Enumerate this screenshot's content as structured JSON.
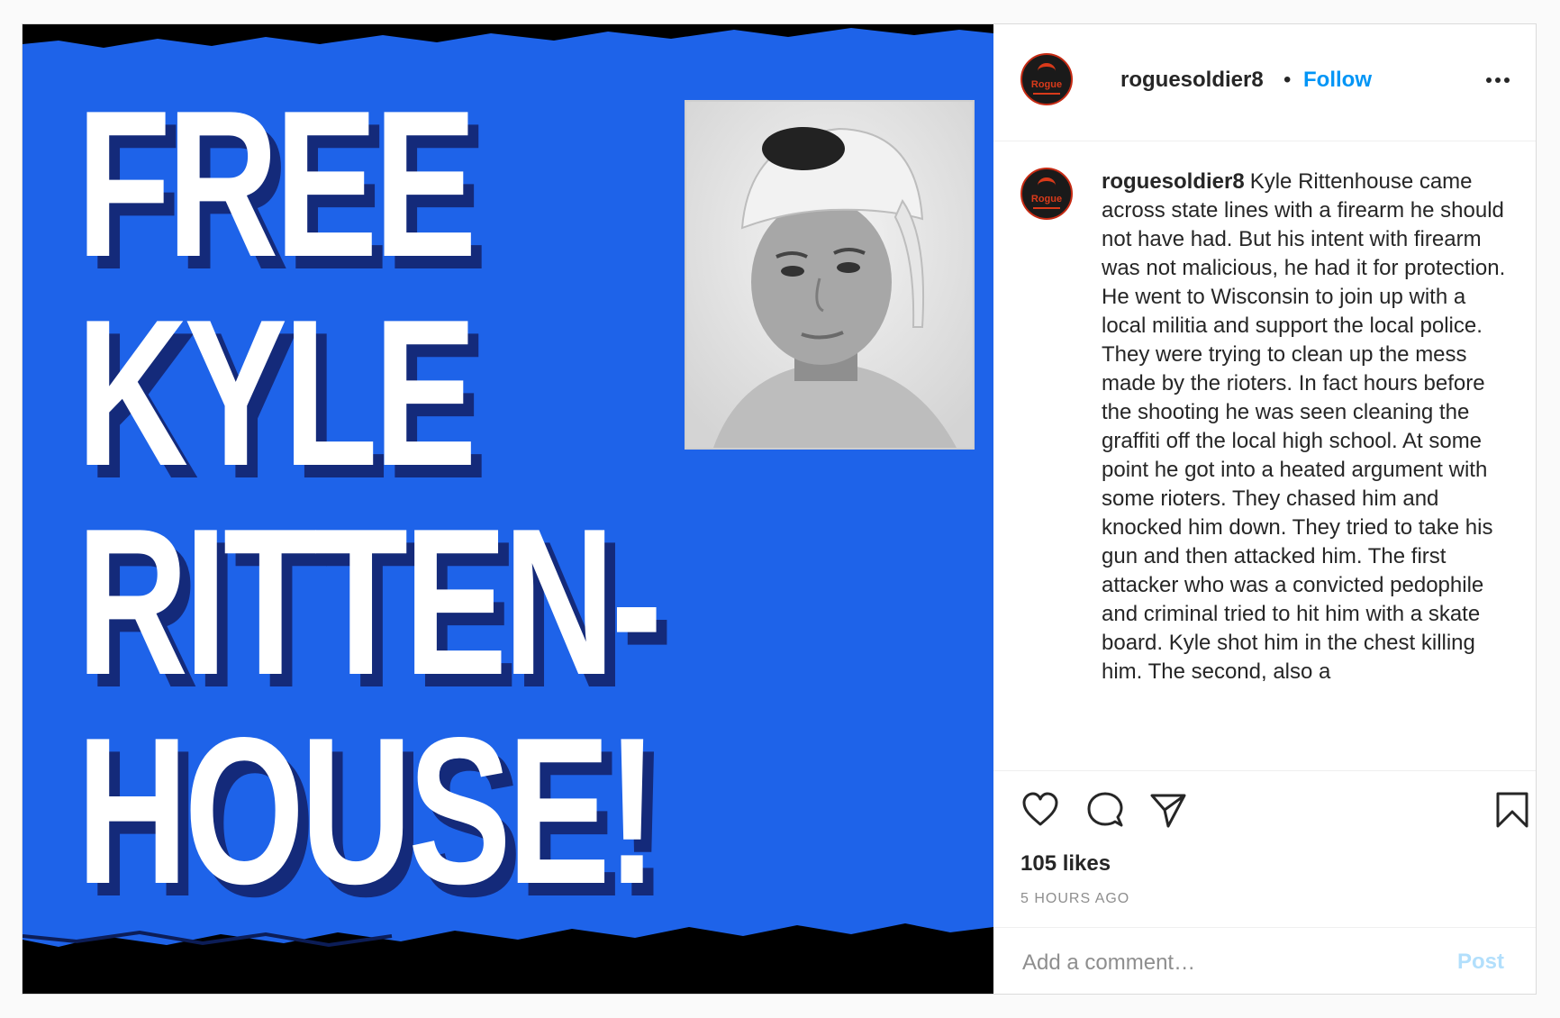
{
  "colors": {
    "poster_blue": "#1e63e9",
    "poster_shadow": "#142a7a",
    "link_blue": "#0095f6",
    "post_button_disabled": "#b2dffc",
    "text": "#262626",
    "muted": "#8e8e8e",
    "avatar_red": "#c62b14"
  },
  "post_image": {
    "headline_lines": [
      "FREE",
      "KYLE",
      "RITTEN-",
      "HOUSE!"
    ],
    "photo_icon": "portrait-photo"
  },
  "header": {
    "avatar_logo_text": "Rogue",
    "username": "roguesoldier8",
    "separator": "•",
    "follow_label": "Follow",
    "more_icon": "ellipsis-icon"
  },
  "caption": {
    "username": "roguesoldier8",
    "text": "Kyle Rittenhouse came across state lines with a firearm he should not have had. But his intent with firearm was not malicious, he had it for protection. He went to Wisconsin to join up with a local militia and support the local police. They were trying to clean up the mess made by the rioters. In fact hours before the shooting he was seen cleaning the graffiti off the local high school. At some point he got into a heated argument with some rioters. They chased him and knocked him down. They tried to take his gun and then attacked him. The first attacker who was a convicted pedophile and criminal tried to hit him with a skate board. Kyle shot him in the chest killing him. The second, also a"
  },
  "actions": {
    "icons": [
      "heart-icon",
      "comment-icon",
      "share-icon",
      "bookmark-icon"
    ],
    "likes": "105 likes",
    "time": "5 HOURS AGO"
  },
  "comment_box": {
    "placeholder": "Add a comment…",
    "post_label": "Post"
  }
}
